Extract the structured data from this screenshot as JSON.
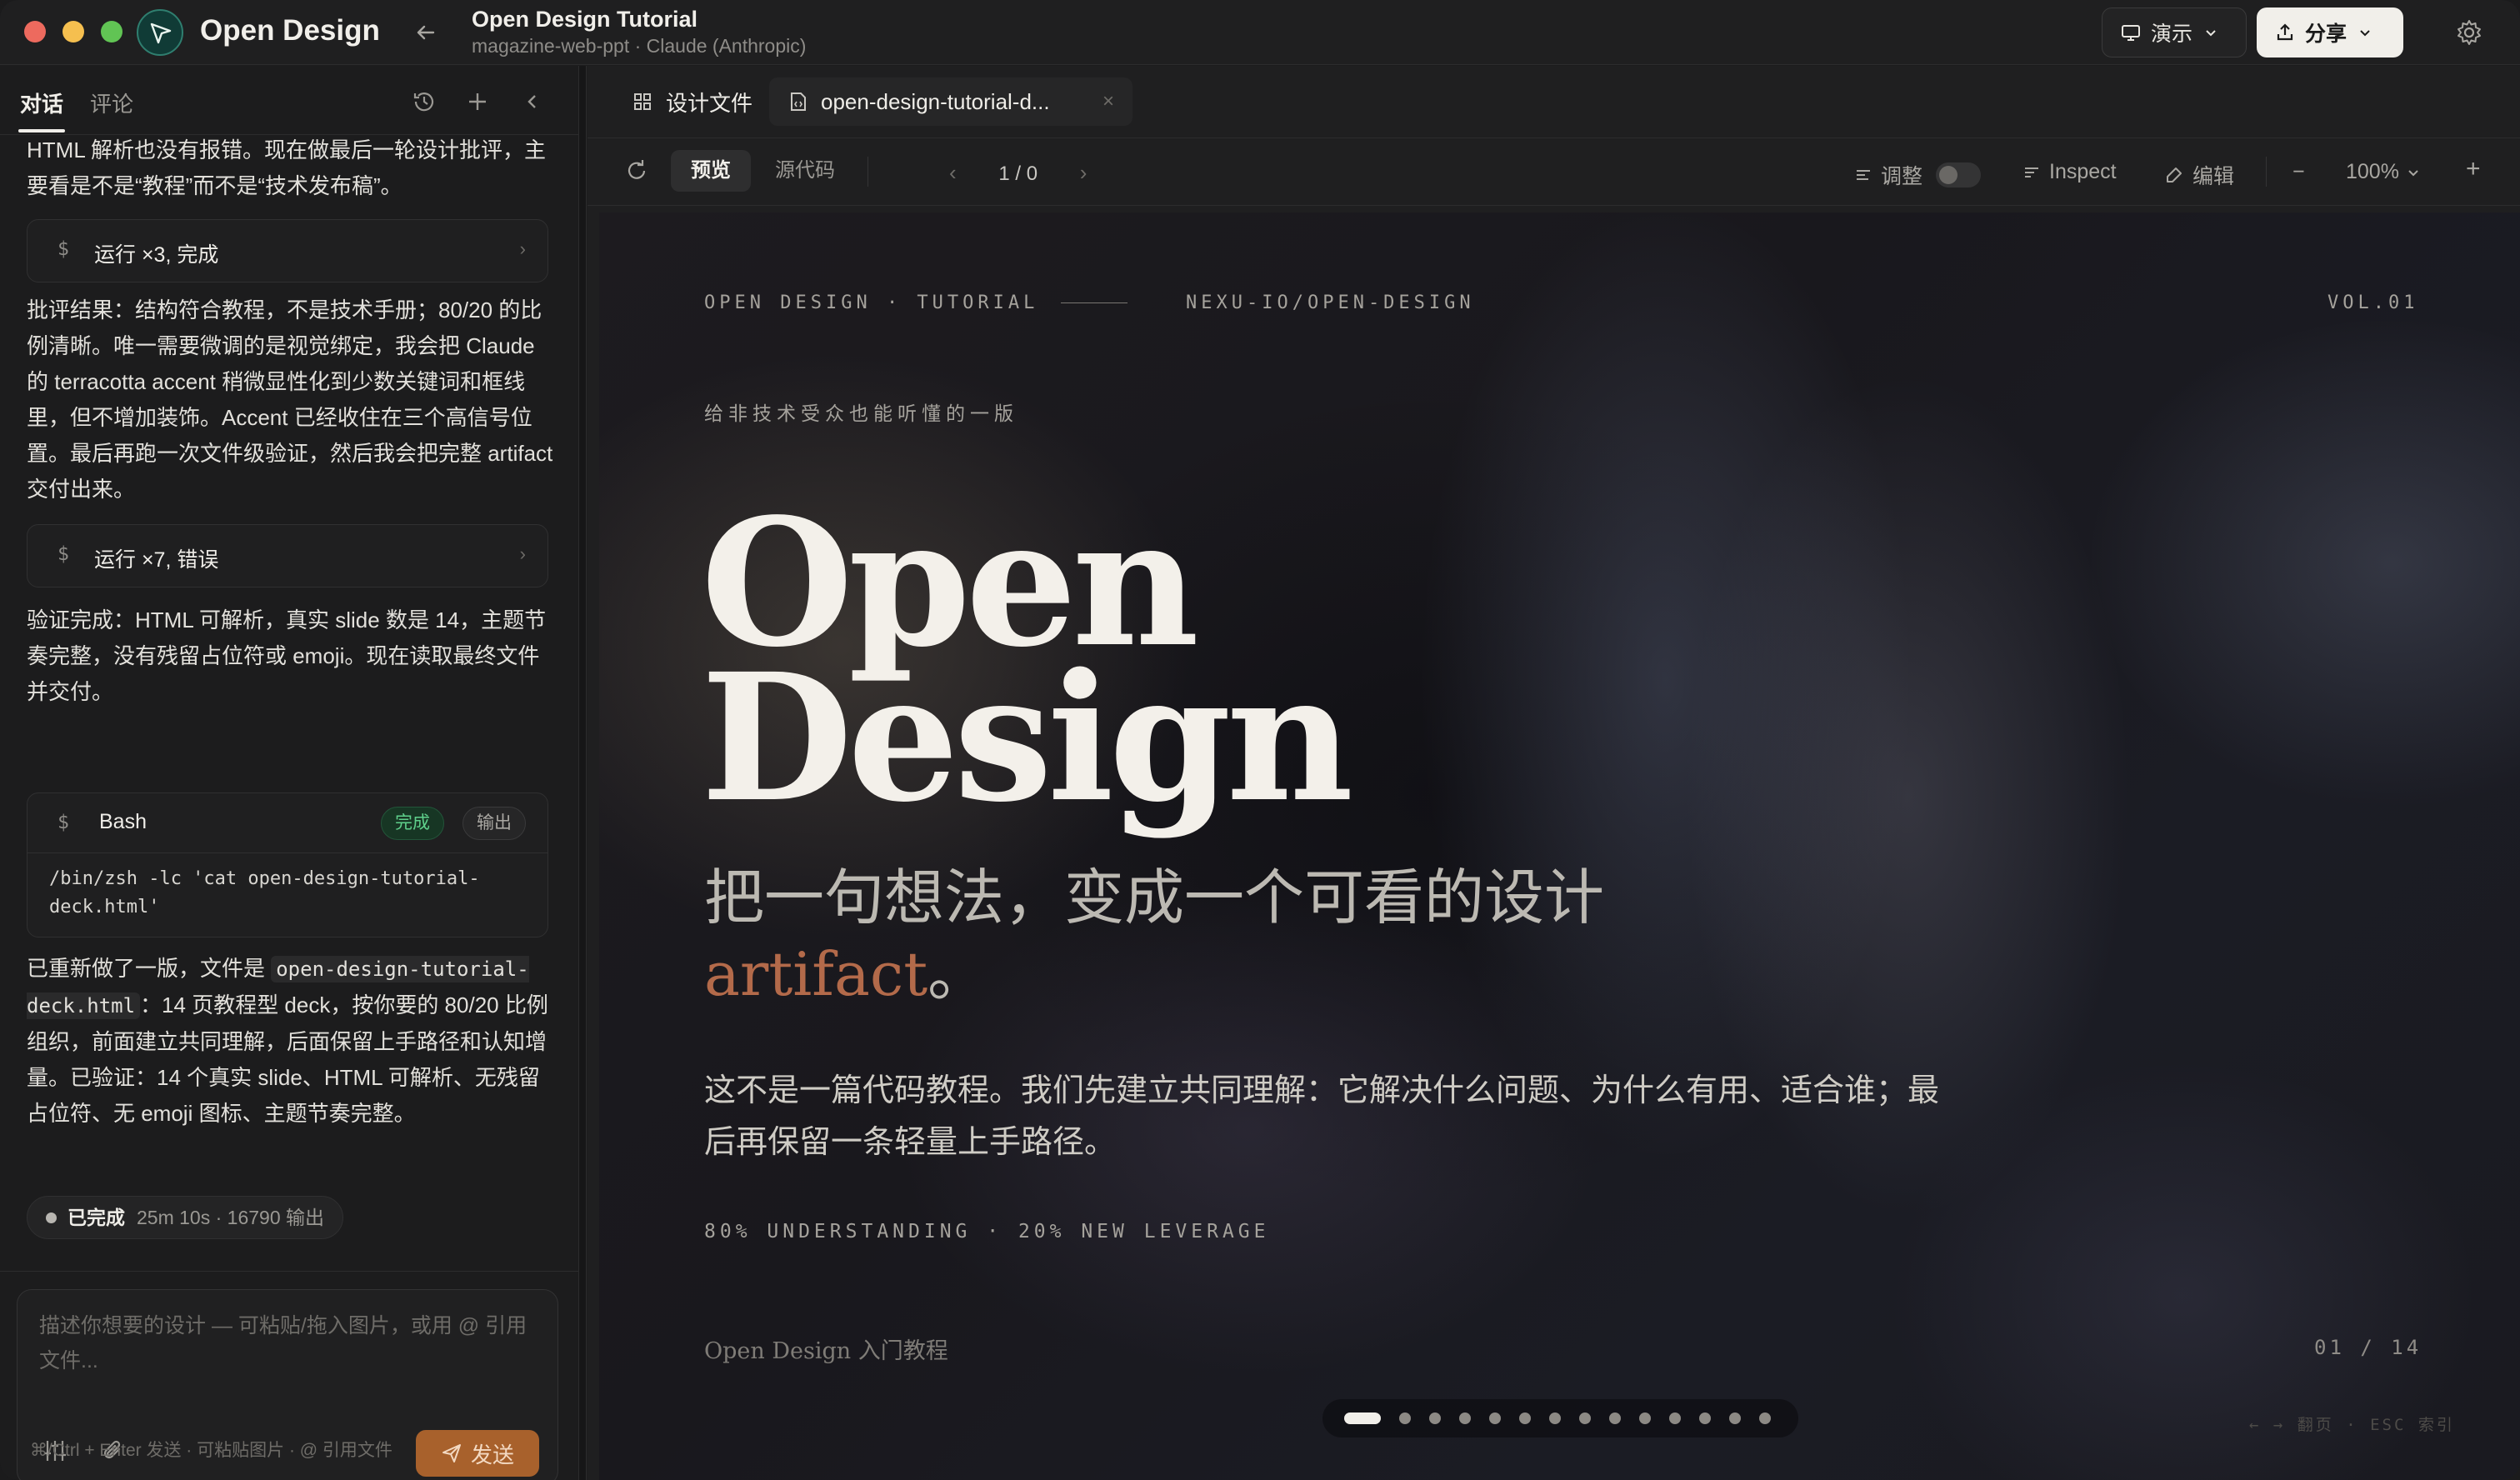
{
  "app": {
    "name": "Open Design"
  },
  "project": {
    "title": "Open Design Tutorial",
    "subtitle": "magazine-web-ppt · Claude (Anthropic)"
  },
  "titlebar": {
    "present_label": "演示",
    "share_label": "分享"
  },
  "left_panel": {
    "tabs": [
      {
        "label": "对话",
        "active": true
      },
      {
        "label": "评论",
        "active": false
      }
    ],
    "messages": {
      "m1": "HTML 解析也没有报错。现在做最后一轮设计批评，主要看是不是“教程”而不是“技术发布稿”。",
      "tool1": "运行 ×3, 完成",
      "m2": "批评结果：结构符合教程，不是技术手册；80/20 的比例清晰。唯一需要微调的是视觉绑定，我会把 Claude 的 terracotta accent 稍微显性化到少数关键词和框线里，但不增加装饰。Accent 已经收住在三个高信号位置。最后再跑一次文件级验证，然后我会把完整 artifact 交付出来。",
      "tool2": "运行 ×7, 错误",
      "m3": "验证完成：HTML 可解析，真实 slide 数是 14，主题节奏完整，没有残留占位符或 emoji。现在读取最终文件并交付。",
      "bash": {
        "title": "Bash",
        "status": "完成",
        "output_label": "输出",
        "command": "/bin/zsh -lc 'cat open-design-tutorial-deck.html'"
      },
      "m4_pre": "已重新做了一版，文件是 ",
      "m4_code": "open-design-tutorial-deck.html",
      "m4_post": "：14 页教程型 deck，按你要的 80/20 比例组织，前面建立共同理解，后面保留上手路径和认知增量。已验证：14 个真实 slide、HTML 可解析、无残留占位符、无 emoji 图标、主题节奏完整。"
    },
    "status": {
      "label": "已完成",
      "detail": "25m 10s · 16790 输出"
    },
    "composer": {
      "placeholder": "描述你想要的设计 — 可粘贴/拖入图片，或用 @ 引用文件...",
      "send_label": "发送",
      "hint": "⌘/Ctrl + Enter 发送 · 可粘贴图片 · @ 引用文件"
    }
  },
  "editor": {
    "tabs": [
      {
        "label": "设计文件"
      },
      {
        "label": "open-design-tutorial-d..."
      }
    ],
    "toolbar": {
      "preview_label": "预览",
      "source_label": "源代码",
      "page_indicator": "1 / 0",
      "adjust_label": "调整",
      "inspect_label": "Inspect",
      "edit_label": "编辑",
      "zoom": "100%"
    }
  },
  "slide": {
    "eyebrow_left": "OPEN DESIGN · TUTORIAL",
    "eyebrow_mid": "NEXU-IO/OPEN-DESIGN",
    "eyebrow_right": "VOL.01",
    "kicker": "给非技术受众也能听懂的一版",
    "hero_line1": "Open",
    "hero_line2": "Design",
    "subhead_main": "把一句想法，变成一个可看的设计",
    "subhead_accent": "artifact",
    "subhead_end": "。",
    "description": "这不是一篇代码教程。我们先建立共同理解：它解决什么问题、为什么有用、适合谁；最后再保留一条轻量上手路径。",
    "stat_line": "80% UNDERSTANDING · 20% NEW LEVERAGE",
    "footer_left": "Open Design 入门教程",
    "footer_right": "01 / 14",
    "nav_hint": "← → 翻页 · ESC 索引",
    "current_slide": 1,
    "total_slides": 14
  },
  "colors": {
    "accent": "#b36a4a",
    "send_button": "#a8612c",
    "success": "#5fd08b"
  }
}
